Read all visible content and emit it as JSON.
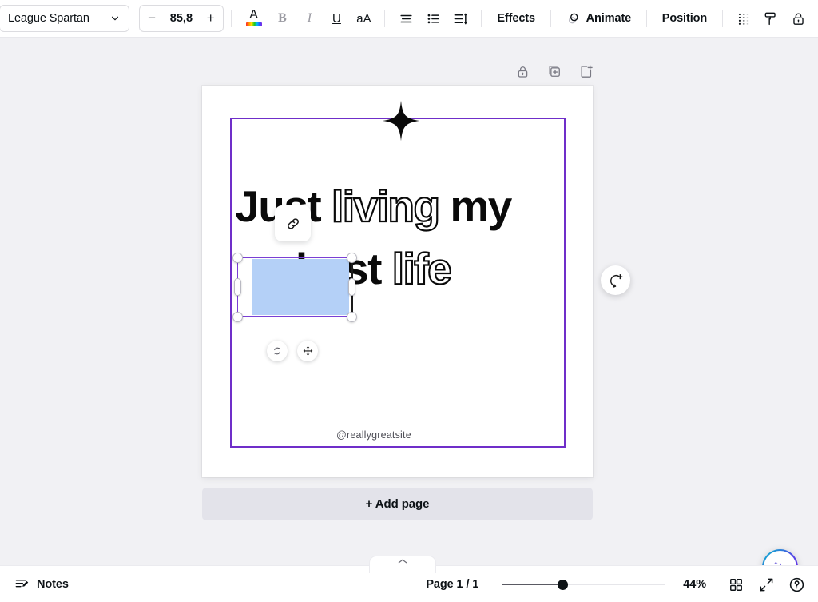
{
  "toolbar": {
    "font_name": "League Spartan",
    "font_size": "85,8",
    "decrease_label": "−",
    "increase_label": "+",
    "bold_label": "B",
    "italic_label": "I",
    "underline_label": "U",
    "text_case_label": "aA",
    "font_color_letter": "A",
    "effects_label": "Effects",
    "animate_label": "Animate",
    "position_label": "Position",
    "icons": {
      "chevron": "chevron-down-icon",
      "font_color": "font-color-icon",
      "align": "text-align-icon",
      "list": "bullet-list-icon",
      "spacing": "line-spacing-icon",
      "animate": "animate-icon",
      "transparency": "transparency-icon",
      "copy_style": "paint-roller-icon",
      "lock": "unlock-icon"
    }
  },
  "page_tools": {
    "lock_label": "lock-page",
    "duplicate_label": "duplicate-page",
    "add_page_label": "add-page"
  },
  "canvas": {
    "frame_color": "#6f2ec9",
    "selection_color": "#7a3fd4",
    "highlight_color": "#b4d0f7",
    "headline": {
      "line1": [
        {
          "text": "Just",
          "style": "solid",
          "selected": true
        },
        {
          "text": "living",
          "style": "outline",
          "selected": false
        },
        {
          "text": "my",
          "style": "solid",
          "selected": false
        }
      ],
      "line2": [
        {
          "text": "best",
          "style": "solid",
          "selected": false
        },
        {
          "text": "life",
          "style": "outline",
          "selected": false
        }
      ]
    },
    "handle_text": "@reallygreatsite",
    "link_chip": "link-icon",
    "rotate_handle": "rotate-icon",
    "move_handle": "move-icon",
    "comment_button": "add-comment-icon",
    "sparkle": "four-point-star"
  },
  "add_page": {
    "label": "+ Add page"
  },
  "magic": {
    "label": "magic-studio-ai"
  },
  "bottom": {
    "notes_label": "Notes",
    "page_indicator": "Page 1 / 1",
    "zoom_percent": "44%",
    "grid_view_label": "grid-view",
    "fullscreen_label": "present-fullscreen",
    "help_label": "help"
  }
}
